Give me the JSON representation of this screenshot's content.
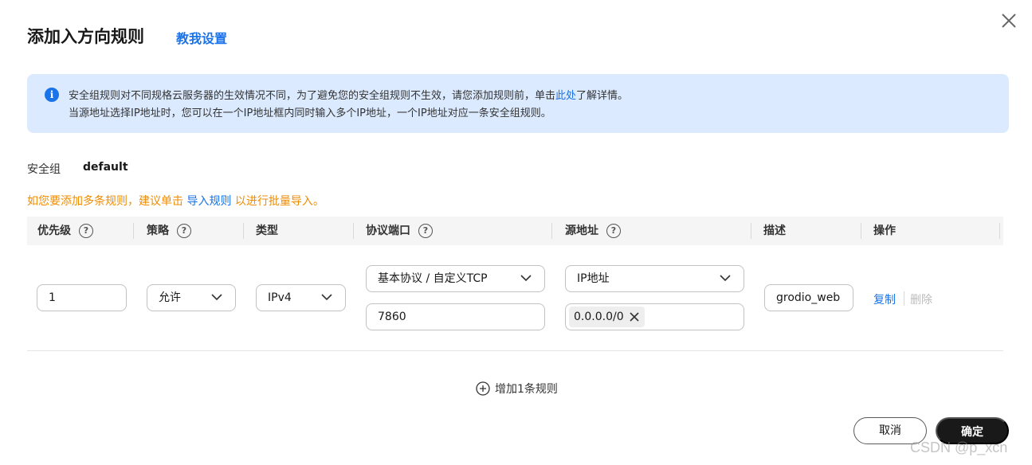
{
  "dialog": {
    "title": "添加入方向规则",
    "help_link": "教我设置",
    "close_icon": "close-icon"
  },
  "info": {
    "icon": "info-icon",
    "line1_before": "安全组规则对不同规格云服务器的生效情况不同，为了避免您的安全组规则不生效，请您添加规则前，单击",
    "line1_link": "此处",
    "line1_after": "了解详情。",
    "line2": "当源地址选择IP地址时，您可以在一个IP地址框内同时输入多个IP地址，一个IP地址对应一条安全组规则。"
  },
  "security_group": {
    "label": "安全组",
    "value": "default"
  },
  "tip": {
    "before": "如您要添加多条规则，建议单击 ",
    "link": "导入规则",
    "after": " 以进行批量导入。"
  },
  "table": {
    "headers": {
      "priority": "优先级",
      "policy": "策略",
      "type": "类型",
      "protocol_port": "协议端口",
      "source": "源地址",
      "description": "描述",
      "actions": "操作"
    },
    "row": {
      "priority": "1",
      "policy": "允许",
      "type": "IPv4",
      "protocol": "基本协议 / 自定义TCP",
      "port": "7860",
      "source_type": "IP地址",
      "source_ip": "0.0.0.0/0",
      "description": "grodio_web",
      "copy": "复制",
      "delete": "删除"
    }
  },
  "add_rule": "增加1条规则",
  "footer": {
    "cancel": "取消",
    "confirm": "确定"
  },
  "watermark": "CSDN @p_xcn",
  "colors": {
    "link": "#1a73e8",
    "warning": "#f08c00",
    "info_bg": "#dbeafe",
    "primary_btn": "#191919"
  }
}
